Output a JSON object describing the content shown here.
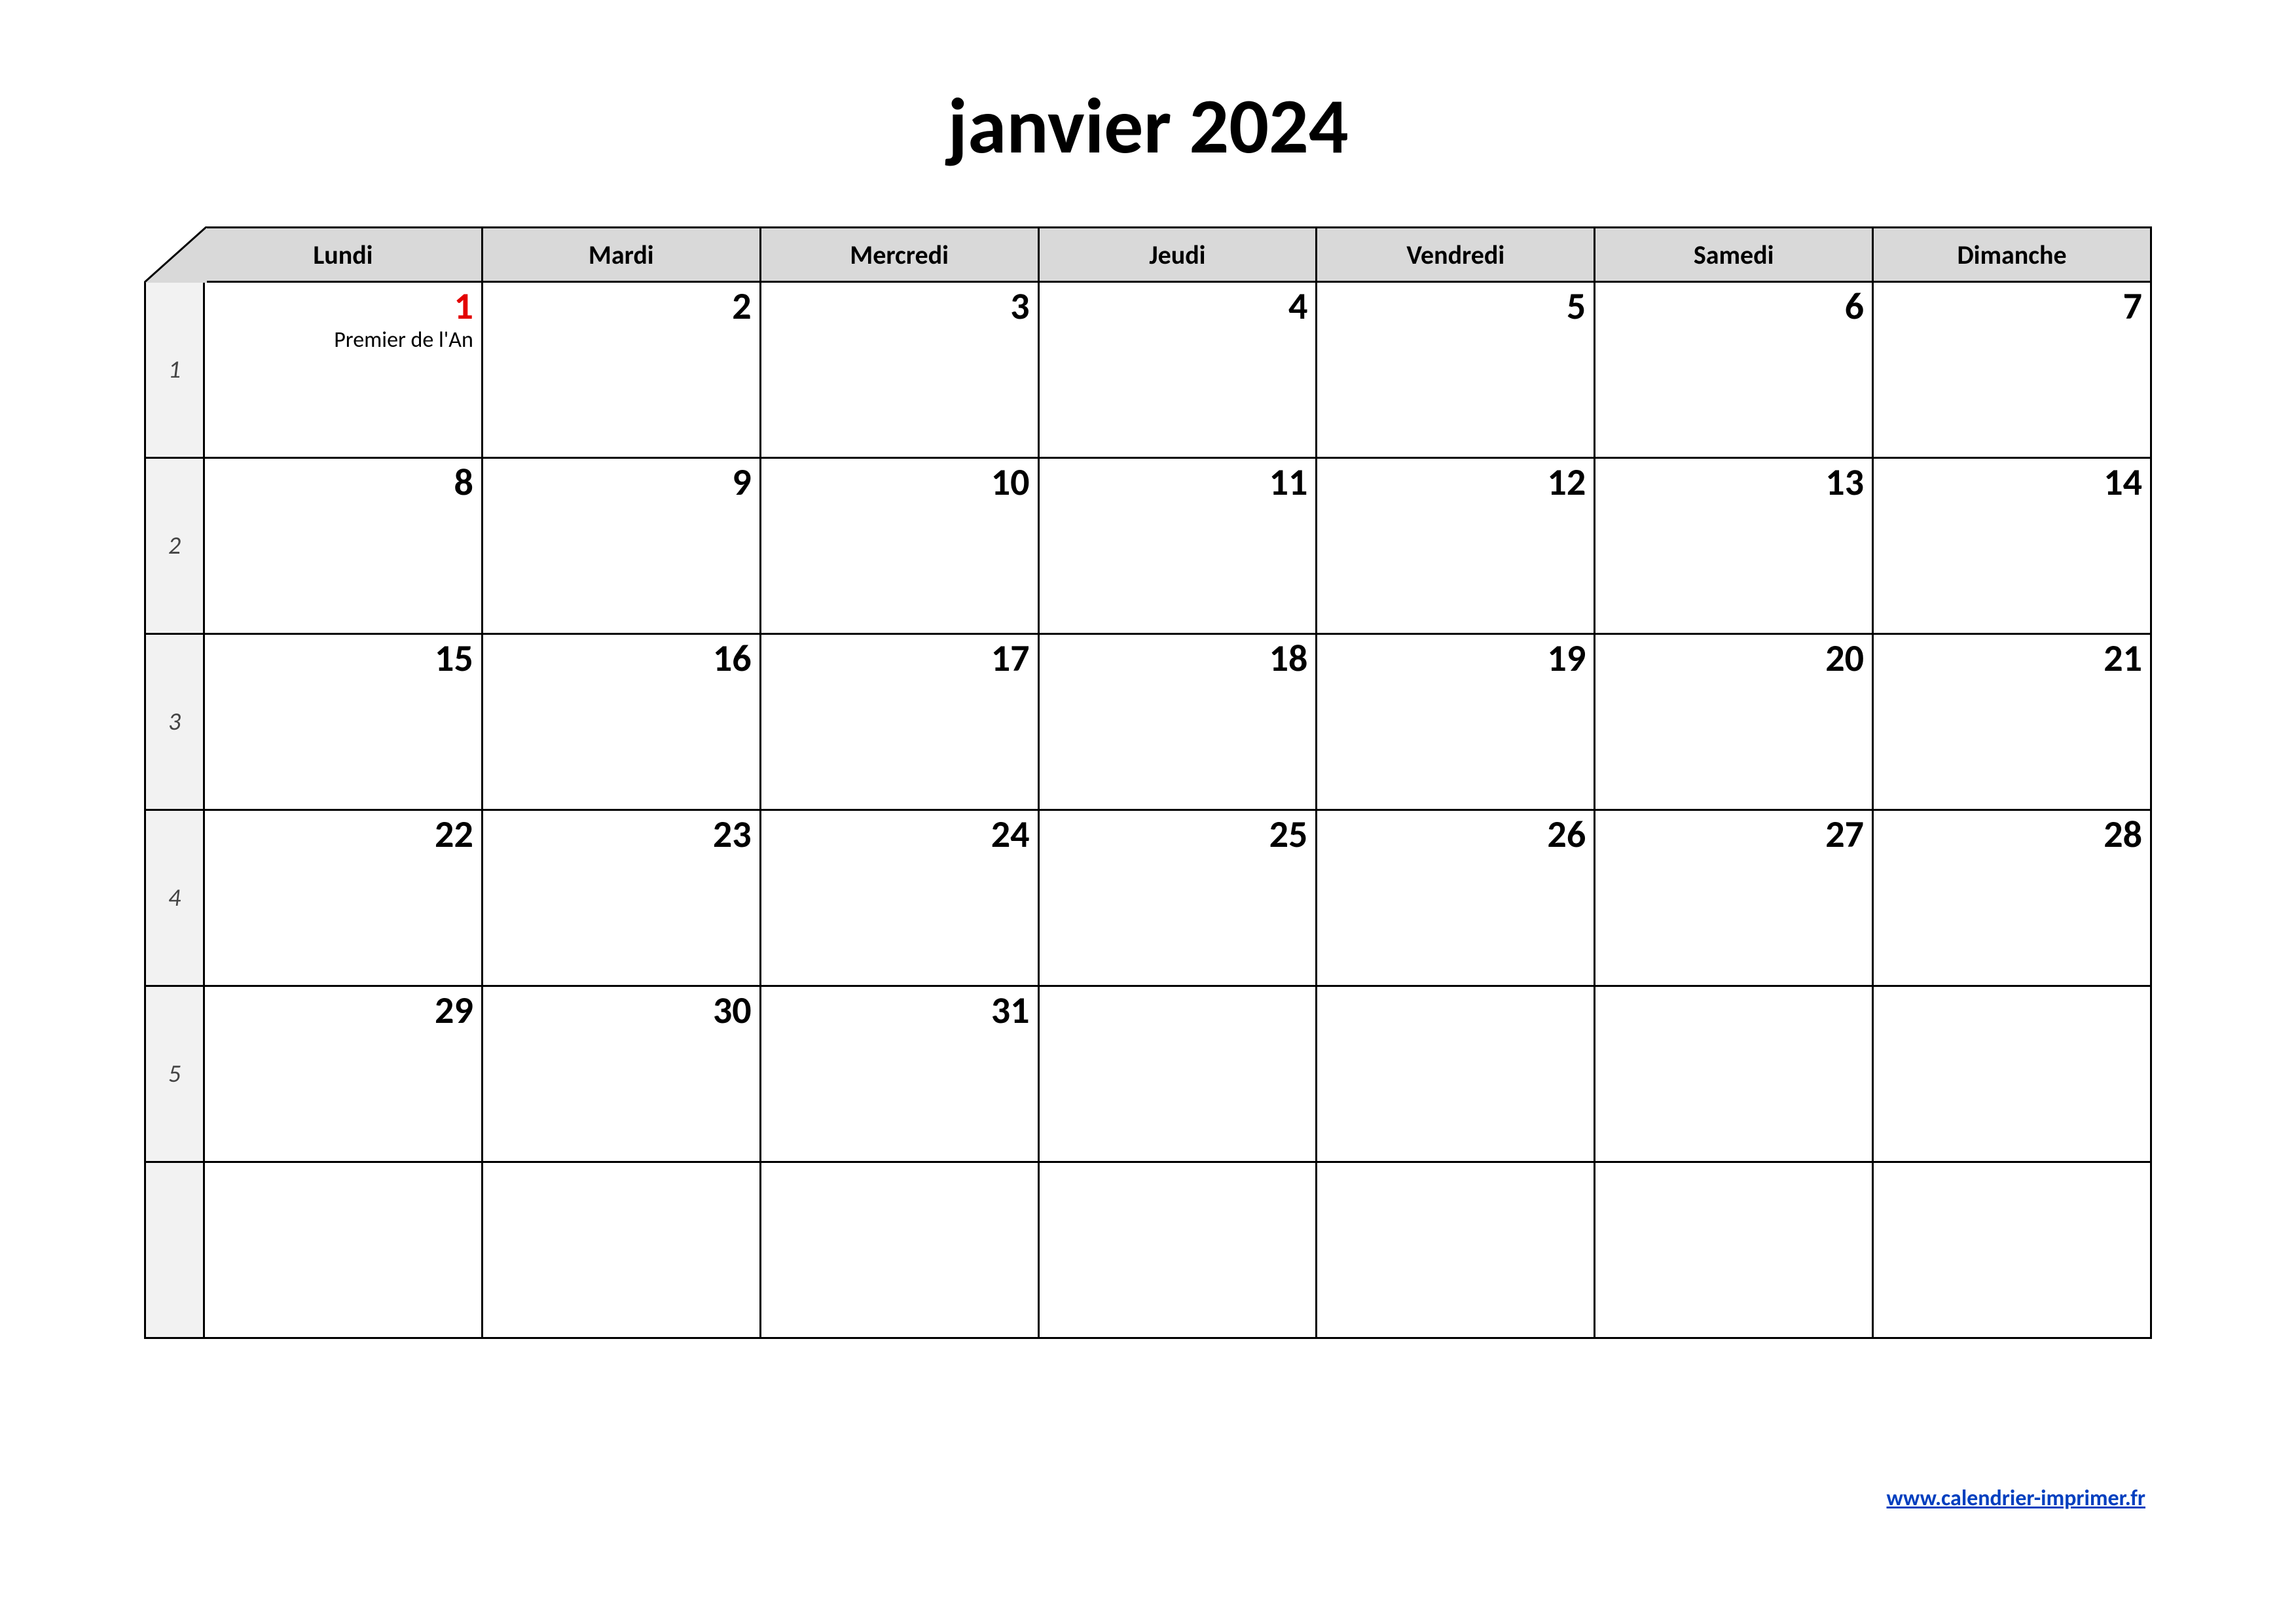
{
  "title": "janvier 2024",
  "days": [
    "Lundi",
    "Mardi",
    "Mercredi",
    "Jeudi",
    "Vendredi",
    "Samedi",
    "Dimanche"
  ],
  "weeks": [
    {
      "num": "1",
      "cells": [
        {
          "d": "1",
          "holiday": true,
          "note": "Premier de l'An"
        },
        {
          "d": "2"
        },
        {
          "d": "3"
        },
        {
          "d": "4"
        },
        {
          "d": "5"
        },
        {
          "d": "6"
        },
        {
          "d": "7"
        }
      ]
    },
    {
      "num": "2",
      "cells": [
        {
          "d": "8"
        },
        {
          "d": "9"
        },
        {
          "d": "10"
        },
        {
          "d": "11"
        },
        {
          "d": "12"
        },
        {
          "d": "13"
        },
        {
          "d": "14"
        }
      ]
    },
    {
      "num": "3",
      "cells": [
        {
          "d": "15"
        },
        {
          "d": "16"
        },
        {
          "d": "17"
        },
        {
          "d": "18"
        },
        {
          "d": "19"
        },
        {
          "d": "20"
        },
        {
          "d": "21"
        }
      ]
    },
    {
      "num": "4",
      "cells": [
        {
          "d": "22"
        },
        {
          "d": "23"
        },
        {
          "d": "24"
        },
        {
          "d": "25"
        },
        {
          "d": "26"
        },
        {
          "d": "27"
        },
        {
          "d": "28"
        }
      ]
    },
    {
      "num": "5",
      "cells": [
        {
          "d": "29"
        },
        {
          "d": "30"
        },
        {
          "d": "31"
        },
        {
          "d": ""
        },
        {
          "d": ""
        },
        {
          "d": ""
        },
        {
          "d": ""
        }
      ]
    },
    {
      "num": "",
      "cells": [
        {
          "d": ""
        },
        {
          "d": ""
        },
        {
          "d": ""
        },
        {
          "d": ""
        },
        {
          "d": ""
        },
        {
          "d": ""
        },
        {
          "d": ""
        }
      ]
    }
  ],
  "footer_link": "www.calendrier-imprimer.fr"
}
